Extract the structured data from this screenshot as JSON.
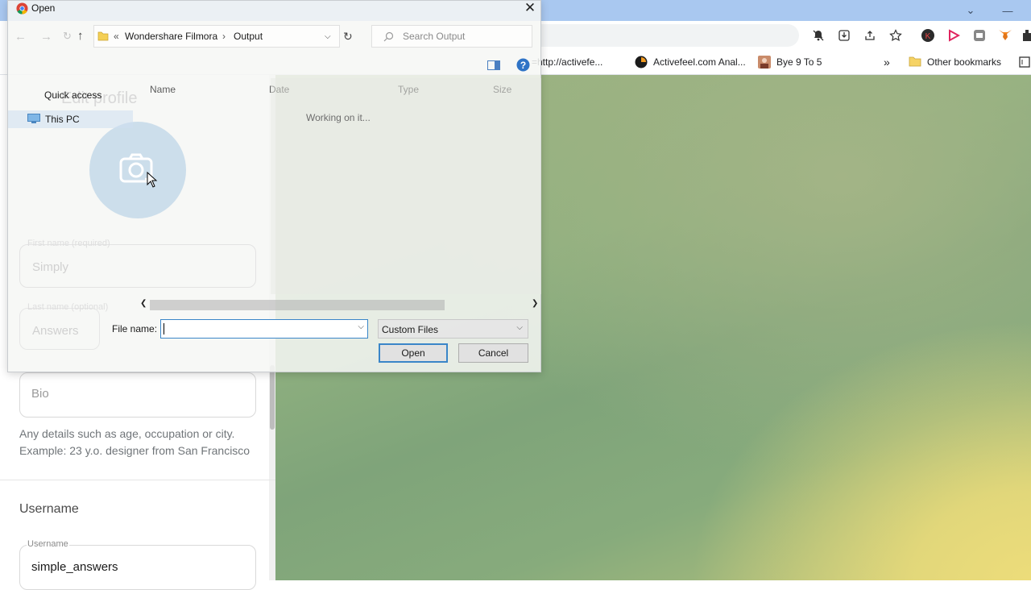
{
  "browser": {
    "bookmarks": [
      {
        "label": "=http://activefe...",
        "icon": "globe-icon"
      },
      {
        "label": "Activefeel.com Anal...",
        "icon": "activefeel-icon"
      },
      {
        "label": "Bye 9 To 5",
        "icon": "person-icon"
      },
      {
        "label": "»",
        "icon": "overflow-chevron-icon"
      },
      {
        "label": "Other bookmarks",
        "icon": "folder-icon"
      }
    ]
  },
  "page": {
    "ghost_title": "Edit profile",
    "first_name_label": "First name (required)",
    "first_name_value": "Simply",
    "last_name_label": "Last name (optional)",
    "last_name_value": "Answers",
    "bio_placeholder": "Bio",
    "bio_hint_line1": "Any details such as age, occupation or city.",
    "bio_hint_line2": "Example: 23 y.o. designer from San Francisco",
    "username_section": "Username",
    "username_label": "Username",
    "username_value": "simple_answers"
  },
  "dialog": {
    "title": "Open",
    "path": [
      "Wondershare Filmora",
      "Output"
    ],
    "path_prefix": "«",
    "search_placeholder": "Search Output",
    "nav": {
      "quick_access": "Quick access",
      "this_pc": "This PC"
    },
    "columns": {
      "name": "Name",
      "date": "Date",
      "type": "Type",
      "size": "Size"
    },
    "status": "Working on it...",
    "file_name_label": "File name:",
    "file_name_value": "",
    "file_type": "Custom Files",
    "open_button": "Open",
    "cancel_button": "Cancel"
  },
  "colors": {
    "accent_blue": "#3a86c8",
    "titlebar": "#a9c8f0",
    "desktop_green": "#8fb07f",
    "desktop_yellow": "#ecdc7a"
  }
}
